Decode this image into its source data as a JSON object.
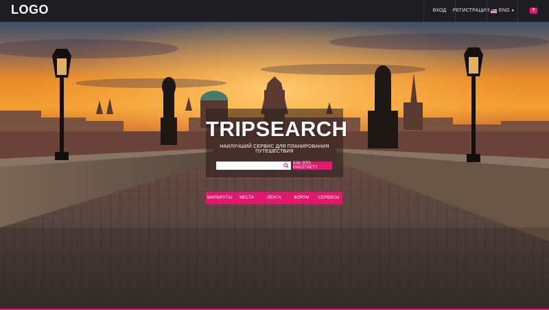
{
  "header": {
    "logo": "LOGO",
    "login": "ВХОД",
    "register": "РЕГИСТРАЦИЯ",
    "language": "ENG",
    "help": "?"
  },
  "hero": {
    "title": "TRIPSEARCH",
    "subtitle": "НАИЛУЧШИЙ СЕРВИС ДЛЯ ПЛАНИРОВАНИЯ ПУТЕШЕСТВИЯ",
    "search_value": "",
    "search_placeholder": "",
    "how_button": "КАК ЭТО РАБОТАЕТ?"
  },
  "menu": {
    "items": [
      {
        "label": "МАРШРУТЫ"
      },
      {
        "label": "МЕСТА"
      },
      {
        "label": "ЛЕНТА"
      },
      {
        "label": "ФОРУМ"
      },
      {
        "label": "СЕРВИСЫ"
      }
    ]
  },
  "colors": {
    "accent": "#e2176e",
    "topbar": "#1e1e22"
  },
  "icons": {
    "search": "search-icon",
    "flag": "us-flag-icon",
    "caret": "chevron-down-icon"
  }
}
